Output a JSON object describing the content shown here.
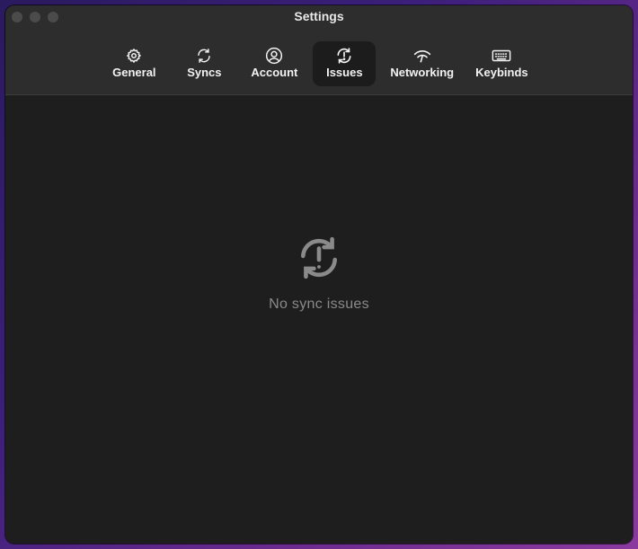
{
  "window": {
    "title": "Settings"
  },
  "tabs": [
    {
      "label": "General",
      "icon": "gear-icon",
      "active": false
    },
    {
      "label": "Syncs",
      "icon": "sync-icon",
      "active": false
    },
    {
      "label": "Account",
      "icon": "account-icon",
      "active": false
    },
    {
      "label": "Issues",
      "icon": "sync-issue-icon",
      "active": true
    },
    {
      "label": "Networking",
      "icon": "wifi-icon",
      "active": false
    },
    {
      "label": "Keybinds",
      "icon": "keyboard-icon",
      "active": false
    }
  ],
  "main": {
    "empty_state_icon": "sync-issue-icon",
    "empty_state_text": "No sync issues"
  },
  "colors": {
    "window_bg": "#1e1e1e",
    "titlebar_bg": "#2d2d2d",
    "active_tab_bg": "#1c1c1c",
    "muted_text": "#8a8a8a"
  }
}
